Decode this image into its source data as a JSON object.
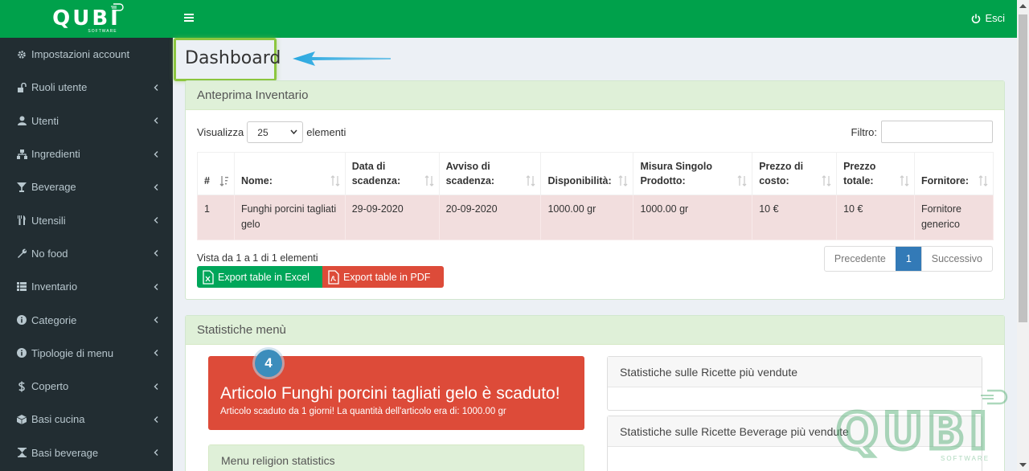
{
  "app": {
    "logo": "QUBI",
    "logo_sub": "SOFTWARE"
  },
  "header": {
    "logout_label": "Esci"
  },
  "sidebar": {
    "items": [
      {
        "label": "Impostazioni account",
        "icon": "gear-icon",
        "has_children": false
      },
      {
        "label": "Ruoli utente",
        "icon": "unlock-icon",
        "has_children": true
      },
      {
        "label": "Utenti",
        "icon": "user-icon",
        "has_children": true
      },
      {
        "label": "Ingredienti",
        "icon": "sitemap-icon",
        "has_children": true
      },
      {
        "label": "Beverage",
        "icon": "glass-icon",
        "has_children": true
      },
      {
        "label": "Utensili",
        "icon": "cutlery-icon",
        "has_children": true
      },
      {
        "label": "No food",
        "icon": "wrench-icon",
        "has_children": true
      },
      {
        "label": "Inventario",
        "icon": "list-icon",
        "has_children": true
      },
      {
        "label": "Categorie",
        "icon": "info-icon",
        "has_children": true
      },
      {
        "label": "Tipologie di menu",
        "icon": "info-icon",
        "has_children": true
      },
      {
        "label": "Coperto",
        "icon": "dollar-icon",
        "has_children": true
      },
      {
        "label": "Basi cucina",
        "icon": "cube-icon",
        "has_children": true
      },
      {
        "label": "Basi beverage",
        "icon": "hourglass-icon",
        "has_children": true
      }
    ]
  },
  "page": {
    "title": "Dashboard"
  },
  "inventory": {
    "title": "Anteprima Inventario",
    "show_label": "Visualizza",
    "show_value": "25",
    "elements_label": "elementi",
    "filter_label": "Filtro:",
    "columns": [
      "#",
      "Nome:",
      "Data di scadenza:",
      "Avviso di scadenza:",
      "Disponibilità:",
      "Misura Singolo Prodotto:",
      "Prezzo di costo:",
      "Prezzo totale:",
      "Fornitore:"
    ],
    "rows": [
      [
        "1",
        "Funghi porcini tagliati gelo",
        "29-09-2020",
        "20-09-2020",
        "1000.00 gr",
        "1000.00 gr",
        "10 €",
        "10 €",
        "Fornitore generico"
      ]
    ],
    "info": "Vista da 1 a 1 di 1 elementi",
    "export_excel": "Export table in Excel",
    "export_pdf": "Export table in PDF",
    "pager": {
      "prev": "Precedente",
      "current": "1",
      "next": "Successivo"
    }
  },
  "stats": {
    "title": "Statistiche menù",
    "badge": "4",
    "alert_title": "Articolo Funghi porcini tagliati gelo è scaduto!",
    "alert_sub": "Articolo scaduto da 1 giorni! La quantità dell'articolo era di: 1000.00 gr",
    "panel_recipes": "Statistiche sulle Ricette più vendute",
    "panel_beverage": "Statistiche sulle Ricette Beverage più vendute",
    "panel_religion": "Menu religion statistics"
  },
  "colors": {
    "brand": "#00a14b",
    "sidebar": "#222d32",
    "danger": "#dd4b39",
    "primary": "#337ab7"
  }
}
